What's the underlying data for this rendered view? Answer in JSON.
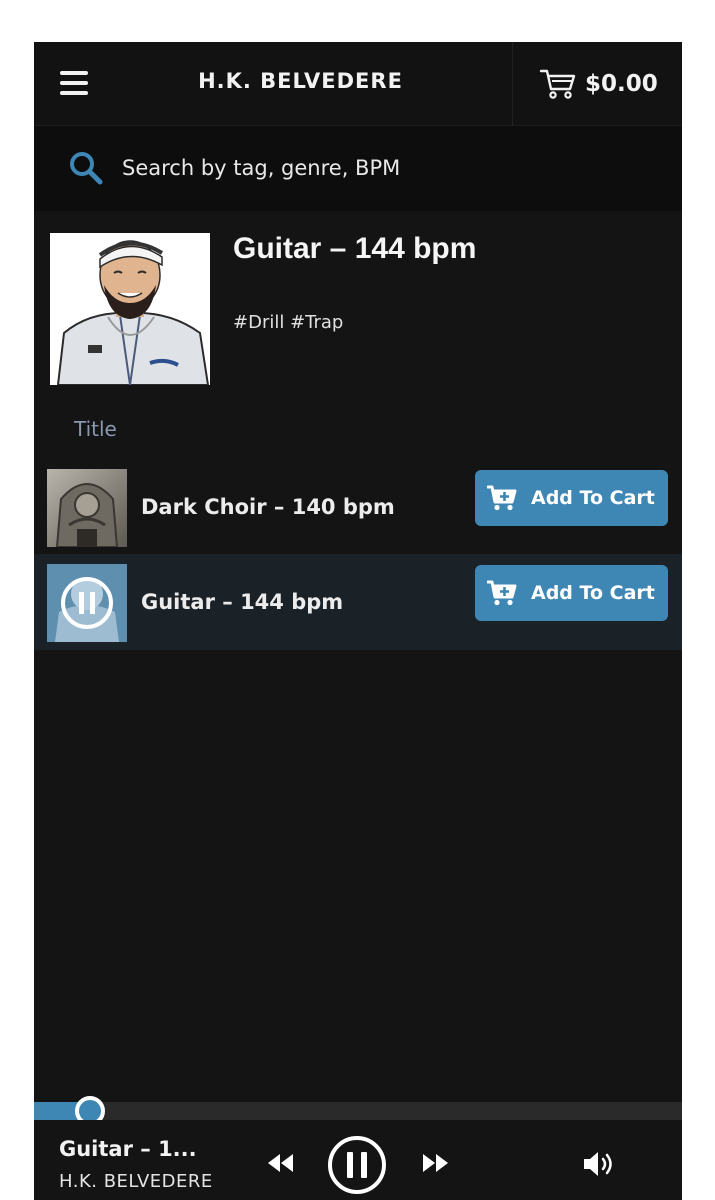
{
  "header": {
    "brand": "H.K. BELVEDERE",
    "cart_total": "$0.00"
  },
  "search": {
    "placeholder": "Search by tag, genre, BPM"
  },
  "playlist": {
    "title": "Guitar – 144 bpm",
    "tags": "#Drill #Trap",
    "column_header": "Title"
  },
  "tracks": [
    {
      "name": "Dark Choir – 140 bpm",
      "button_label": "Add To Cart",
      "playing": false
    },
    {
      "name": "Guitar – 144 bpm",
      "button_label": "Add To Cart",
      "playing": true
    }
  ],
  "player": {
    "now_playing_title": "Guitar – 1...",
    "now_playing_artist": "H.K. BELVEDERE",
    "progress_fraction": 0.087
  },
  "icons": {
    "menu": "menu-icon",
    "cart": "cart-icon",
    "search": "search-icon",
    "add_to_cart": "cart-plus-icon",
    "pause": "pause-icon",
    "rewind": "rewind-icon",
    "fast_forward": "fast-forward-icon",
    "volume": "volume-icon"
  },
  "colors": {
    "accent": "#3e86b4",
    "background": "#141414",
    "active_row": "#1a2127",
    "column_header": "#8a98b0"
  }
}
